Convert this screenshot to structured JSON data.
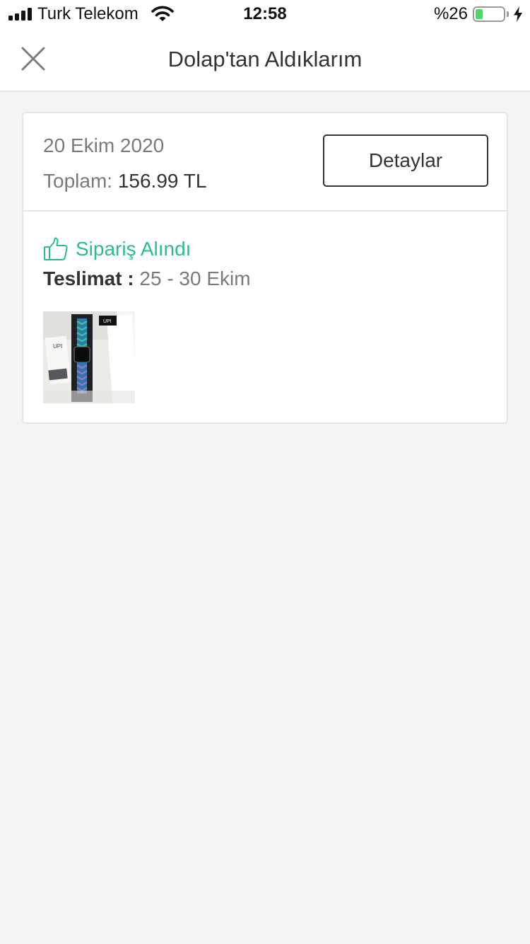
{
  "status_bar": {
    "carrier": "Turk Telekom",
    "time": "12:58",
    "battery_percent": "%26",
    "battery_level": 0.26,
    "signal_icon": "cellular-signal-icon",
    "wifi_icon": "wifi-icon",
    "charging_icon": "bolt-icon",
    "battery_color": "#4cd964"
  },
  "navbar": {
    "title": "Dolap'tan Aldıklarım",
    "close_icon": "close-icon"
  },
  "order": {
    "date": "20 Ekim 2020",
    "total_label": "Toplam:",
    "total_amount": "156.99 TL",
    "details_button": "Detaylar",
    "status_icon": "thumbs-up-icon",
    "status": "Sipariş Alındı",
    "status_color": "#2bbd8e",
    "delivery_label": "Teslimat :",
    "delivery_value": "25 - 30 Ekim",
    "product_image": "watch-band-product-image",
    "product_brand_mark": "UPI"
  }
}
